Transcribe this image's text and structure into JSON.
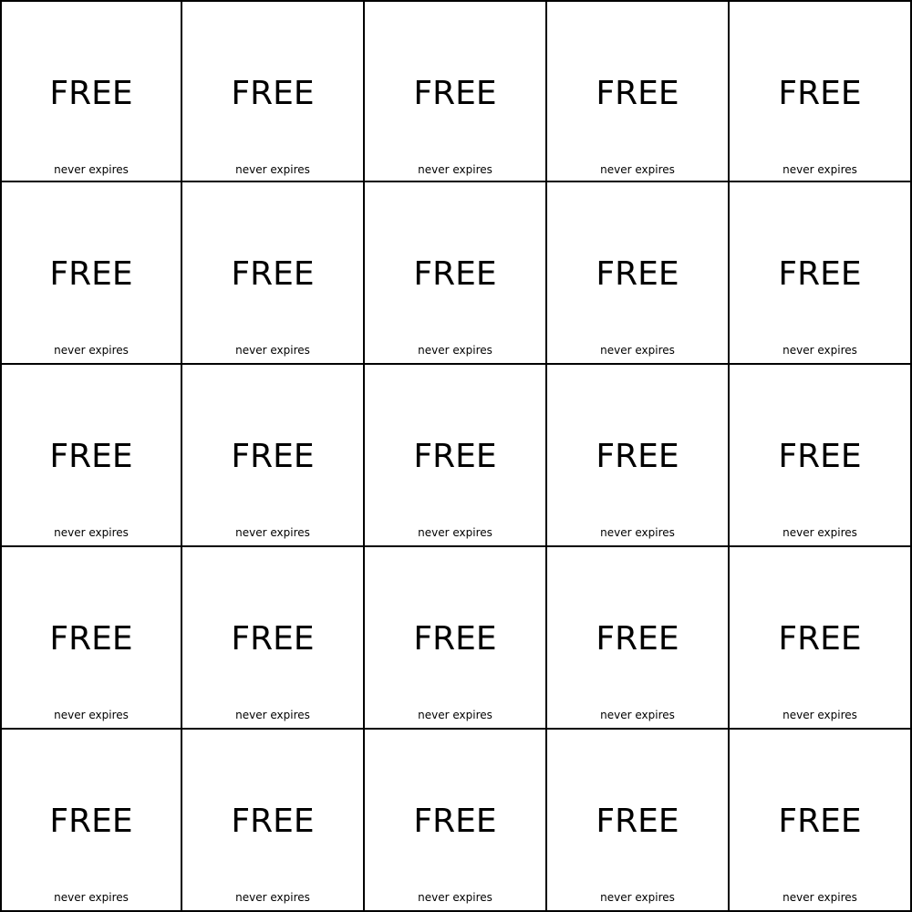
{
  "board": {
    "rows": 5,
    "columns": 5,
    "border_color": "#000000",
    "background_color": "#ffffff",
    "tiles": [
      {
        "label": "FREE",
        "subtext": "never expires"
      },
      {
        "label": "FREE",
        "subtext": "never expires"
      },
      {
        "label": "FREE",
        "subtext": "never expires"
      },
      {
        "label": "FREE",
        "subtext": "never expires"
      },
      {
        "label": "FREE",
        "subtext": "never expires"
      },
      {
        "label": "FREE",
        "subtext": "never expires"
      },
      {
        "label": "FREE",
        "subtext": "never expires"
      },
      {
        "label": "FREE",
        "subtext": "never expires"
      },
      {
        "label": "FREE",
        "subtext": "never expires"
      },
      {
        "label": "FREE",
        "subtext": "never expires"
      },
      {
        "label": "FREE",
        "subtext": "never expires"
      },
      {
        "label": "FREE",
        "subtext": "never expires"
      },
      {
        "label": "FREE",
        "subtext": "never expires"
      },
      {
        "label": "FREE",
        "subtext": "never expires"
      },
      {
        "label": "FREE",
        "subtext": "never expires"
      },
      {
        "label": "FREE",
        "subtext": "never expires"
      },
      {
        "label": "FREE",
        "subtext": "never expires"
      },
      {
        "label": "FREE",
        "subtext": "never expires"
      },
      {
        "label": "FREE",
        "subtext": "never expires"
      },
      {
        "label": "FREE",
        "subtext": "never expires"
      },
      {
        "label": "FREE",
        "subtext": "never expires"
      },
      {
        "label": "FREE",
        "subtext": "never expires"
      },
      {
        "label": "FREE",
        "subtext": "never expires"
      },
      {
        "label": "FREE",
        "subtext": "never expires"
      },
      {
        "label": "FREE",
        "subtext": "never expires"
      }
    ]
  }
}
